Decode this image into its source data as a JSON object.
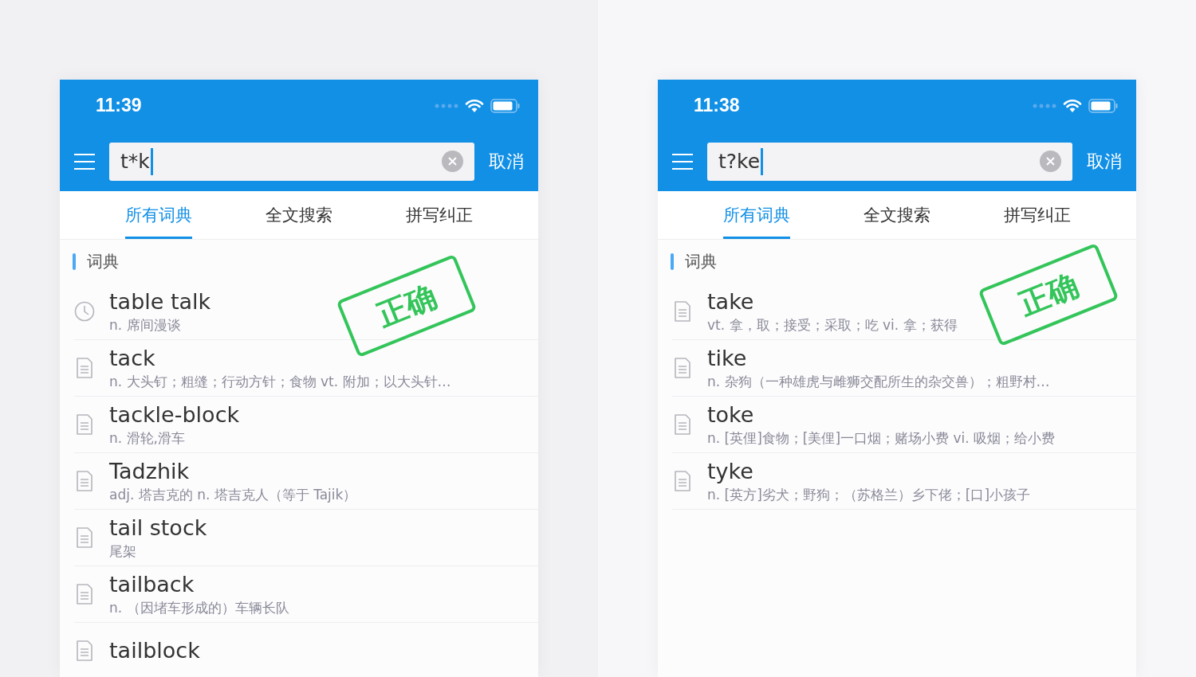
{
  "phones": [
    {
      "status_bar": {
        "time": "11:39"
      },
      "search": {
        "value": "t*k",
        "cancel": "取消"
      },
      "tabs": [
        {
          "label": "所有词典",
          "selected": true
        },
        {
          "label": "全文搜索",
          "selected": false
        },
        {
          "label": "拼写纠正",
          "selected": false
        }
      ],
      "section": "词典",
      "entries": [
        {
          "kind": "history",
          "word": "table talk",
          "definition": "n. 席间漫谈"
        },
        {
          "kind": "entry",
          "word": "tack",
          "definition": "n. 大头钉；粗缝；行动方针；食物 vt. 附加；以大头针…"
        },
        {
          "kind": "entry",
          "word": "tackle-block",
          "definition": "n. 滑轮,滑车"
        },
        {
          "kind": "entry",
          "word": "Tadzhik",
          "definition": "adj. 塔吉克的 n. 塔吉克人（等于 Tajik）"
        },
        {
          "kind": "entry",
          "word": "tail stock",
          "definition": "尾架"
        },
        {
          "kind": "entry",
          "word": "tailback",
          "definition": "n. （因堵车形成的）车辆长队"
        },
        {
          "kind": "entry",
          "word": "tailblock"
        }
      ],
      "stamp": "正确"
    },
    {
      "status_bar": {
        "time": "11:38"
      },
      "search": {
        "value": "t?ke",
        "cancel": "取消"
      },
      "tabs": [
        {
          "label": "所有词典",
          "selected": true
        },
        {
          "label": "全文搜索",
          "selected": false
        },
        {
          "label": "拼写纠正",
          "selected": false
        }
      ],
      "section": "词典",
      "entries": [
        {
          "kind": "entry",
          "word": "take",
          "definition": "vt. 拿，取；接受；采取；吃 vi. 拿；获得"
        },
        {
          "kind": "entry",
          "word": "tike",
          "definition": "n. 杂狗（一种雄虎与雌狮交配所生的杂交兽）；粗野村…"
        },
        {
          "kind": "entry",
          "word": "toke",
          "definition": "n. [英俚]食物；[美俚]一口烟；赌场小费 vi. 吸烟；给小费"
        },
        {
          "kind": "entry",
          "word": "tyke",
          "definition": "n. [英方]劣犬；野狗；（苏格兰）乡下佬；[口]小孩子"
        }
      ],
      "stamp": "正确"
    }
  ]
}
